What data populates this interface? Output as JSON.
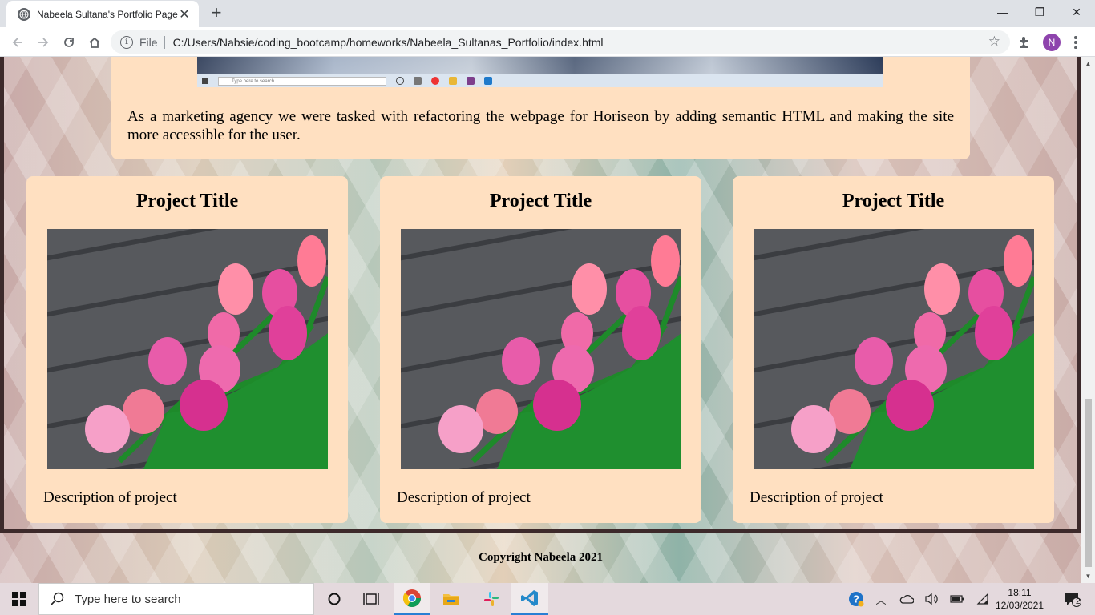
{
  "browser": {
    "tab_title": "Nabeela Sultana's Portfolio Page",
    "tab_close": "✕",
    "new_tab": "+",
    "scheme_label": "File",
    "url": "C:/Users/Nabsie/coding_bootcamp/homeworks/Nabeela_Sultanas_Portfolio/index.html",
    "profile_initial": "N",
    "window_controls": {
      "minimize": "—",
      "restore": "❐",
      "close": "✕"
    }
  },
  "page": {
    "about_text": "As a marketing agency we were tasked with refactoring the webpage for Horiseon by adding semantic HTML and making the site more accessible for the user.",
    "screenshot_search_text": "Type here to search",
    "projects": [
      {
        "title": "Project Title",
        "description": "Description of project"
      },
      {
        "title": "Project Title",
        "description": "Description of project"
      },
      {
        "title": "Project Title",
        "description": "Description of project"
      }
    ],
    "footer": "Copyright Nabeela 2021"
  },
  "taskbar": {
    "search_placeholder": "Type here to search",
    "time": "18:11",
    "date": "12/03/2021",
    "notification_count": "2"
  },
  "colors": {
    "card_bg": "#ffe0c1",
    "frame_border": "#3d2a2b",
    "profile_bg": "#8e44ad"
  }
}
